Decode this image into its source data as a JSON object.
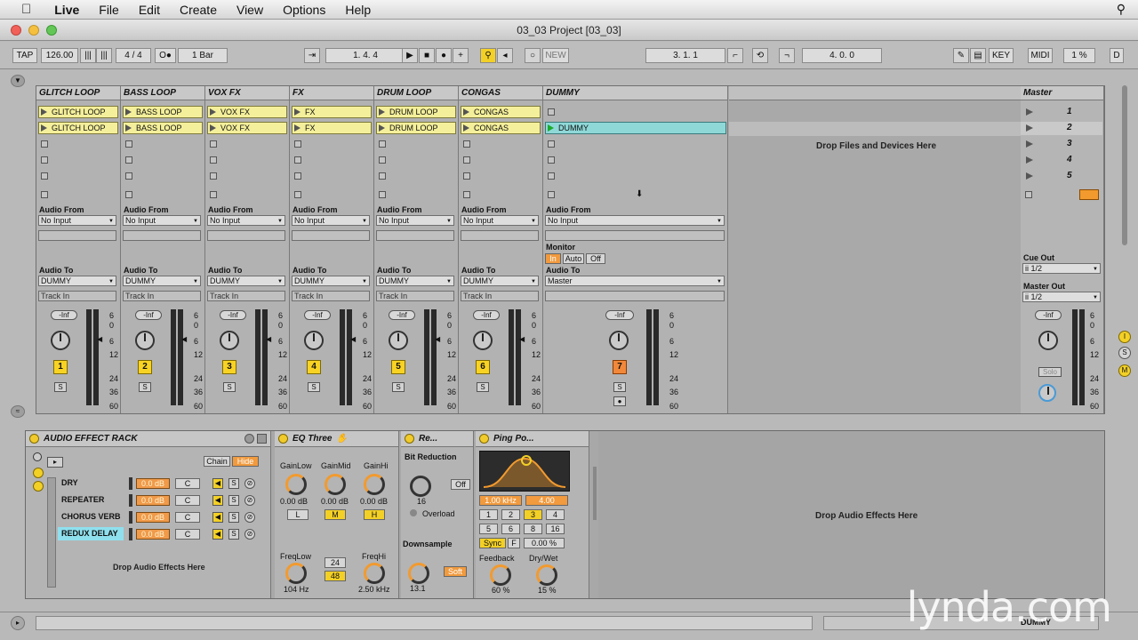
{
  "menubar": {
    "app": "Live",
    "items": [
      "File",
      "Edit",
      "Create",
      "View",
      "Options",
      "Help"
    ]
  },
  "window": {
    "title": "03_03 Project  [03_03]"
  },
  "transport": {
    "tap": "TAP",
    "tempo": "126.00",
    "signature": "4 / 4",
    "quant": "1 Bar",
    "position": "1.   4.   4",
    "new": "NEW",
    "loop_start": "3.   1.   1",
    "loop_len": "4.   0.   0",
    "key": "KEY",
    "midi": "MIDI",
    "cpu": "1 %",
    "d": "D"
  },
  "tracks": [
    {
      "name": "GLITCH LOOP",
      "num": "1",
      "clips": [
        "GLITCH LOOP",
        "GLITCH LOOP"
      ],
      "audio_from": "Audio From",
      "input": "No Input",
      "audio_to": "Audio To",
      "output": "DUMMY",
      "sub": "Track In",
      "vol": "-Inf"
    },
    {
      "name": "BASS LOOP",
      "num": "2",
      "clips": [
        "BASS LOOP",
        "BASS LOOP"
      ],
      "audio_from": "Audio From",
      "input": "No Input",
      "audio_to": "Audio To",
      "output": "DUMMY",
      "sub": "Track In",
      "vol": "-Inf"
    },
    {
      "name": "VOX FX",
      "num": "3",
      "clips": [
        "VOX FX",
        "VOX FX"
      ],
      "audio_from": "Audio From",
      "input": "No Input",
      "audio_to": "Audio To",
      "output": "DUMMY",
      "sub": "Track In",
      "vol": "-Inf"
    },
    {
      "name": "FX",
      "num": "4",
      "clips": [
        "FX",
        "FX"
      ],
      "audio_from": "Audio From",
      "input": "No Input",
      "audio_to": "Audio To",
      "output": "DUMMY",
      "sub": "Track In",
      "vol": "-Inf"
    },
    {
      "name": "DRUM LOOP",
      "num": "5",
      "clips": [
        "DRUM LOOP",
        "DRUM LOOP"
      ],
      "audio_from": "Audio From",
      "input": "No Input",
      "audio_to": "Audio To",
      "output": "DUMMY",
      "sub": "Track In",
      "vol": "-Inf"
    },
    {
      "name": "CONGAS",
      "num": "6",
      "clips": [
        "CONGAS",
        "CONGAS"
      ],
      "audio_from": "Audio From",
      "input": "No Input",
      "audio_to": "Audio To",
      "output": "DUMMY",
      "sub": "Track In",
      "vol": "-Inf"
    }
  ],
  "dummy": {
    "name": "DUMMY",
    "num": "7",
    "clip": "DUMMY",
    "audio_from": "Audio From",
    "input": "No Input",
    "monitor": "Monitor",
    "mon_in": "In",
    "mon_auto": "Auto",
    "mon_off": "Off",
    "audio_to": "Audio To",
    "output": "Master",
    "vol": "-Inf"
  },
  "drop_files": "Drop Files and Devices Here",
  "master": {
    "name": "Master",
    "scenes": [
      "1",
      "2",
      "3",
      "4",
      "5"
    ],
    "cue_out_label": "Cue Out",
    "cue_out": "ii 1/2",
    "master_out_label": "Master Out",
    "master_out": "ii 1/2",
    "vol": "-Inf",
    "solo": "Solo"
  },
  "meter_scale": [
    "6",
    "0",
    "6",
    "12",
    "24",
    "36",
    "60"
  ],
  "rack": {
    "title": "AUDIO EFFECT RACK",
    "chain_btn": "Chain",
    "hide_btn": "Hide",
    "chains": [
      {
        "name": "DRY",
        "vol": "0.0 dB"
      },
      {
        "name": "REPEATER",
        "vol": "0.0 dB"
      },
      {
        "name": "CHORUS VERB",
        "vol": "0.0 dB"
      },
      {
        "name": "REDUX DELAY",
        "vol": "0.0 dB"
      }
    ],
    "c_label": "C",
    "s_label": "S",
    "drop_text": "Drop Audio Effects Here"
  },
  "eq": {
    "title": "EQ Three",
    "gainlow": "GainLow",
    "gainmid": "GainMid",
    "gainhi": "GainHi",
    "gv_low": "0.00 dB",
    "gv_mid": "0.00 dB",
    "gv_hi": "0.00 dB",
    "l": "L",
    "m": "M",
    "h": "H",
    "freqlow": "FreqLow",
    "freqhi": "FreqHi",
    "fl_val": "104 Hz",
    "fh_val": "2.50 kHz",
    "slope_24": "24",
    "slope_48": "48"
  },
  "redux": {
    "title": "Re...",
    "bit_reduction": "Bit Reduction",
    "bit_val": "16",
    "off": "Off",
    "overload": "Overload",
    "downsample": "Downsample",
    "ds_val": "13.1",
    "soft": "Soft"
  },
  "pingpong": {
    "title": "Ping Po...",
    "freq": "1.00 kHz",
    "width": "4.00",
    "times": [
      "1",
      "2",
      "3",
      "4",
      "5",
      "6",
      "8",
      "16"
    ],
    "sync": "Sync",
    "f": "F",
    "pct": "0.00 %",
    "feedback": "Feedback",
    "drywet": "Dry/Wet",
    "fb_val": "60 %",
    "dw_val": "15 %"
  },
  "drop_effects": "Drop Audio Effects Here",
  "bottom_track": "DUMMY",
  "watermark": "lynda.com"
}
